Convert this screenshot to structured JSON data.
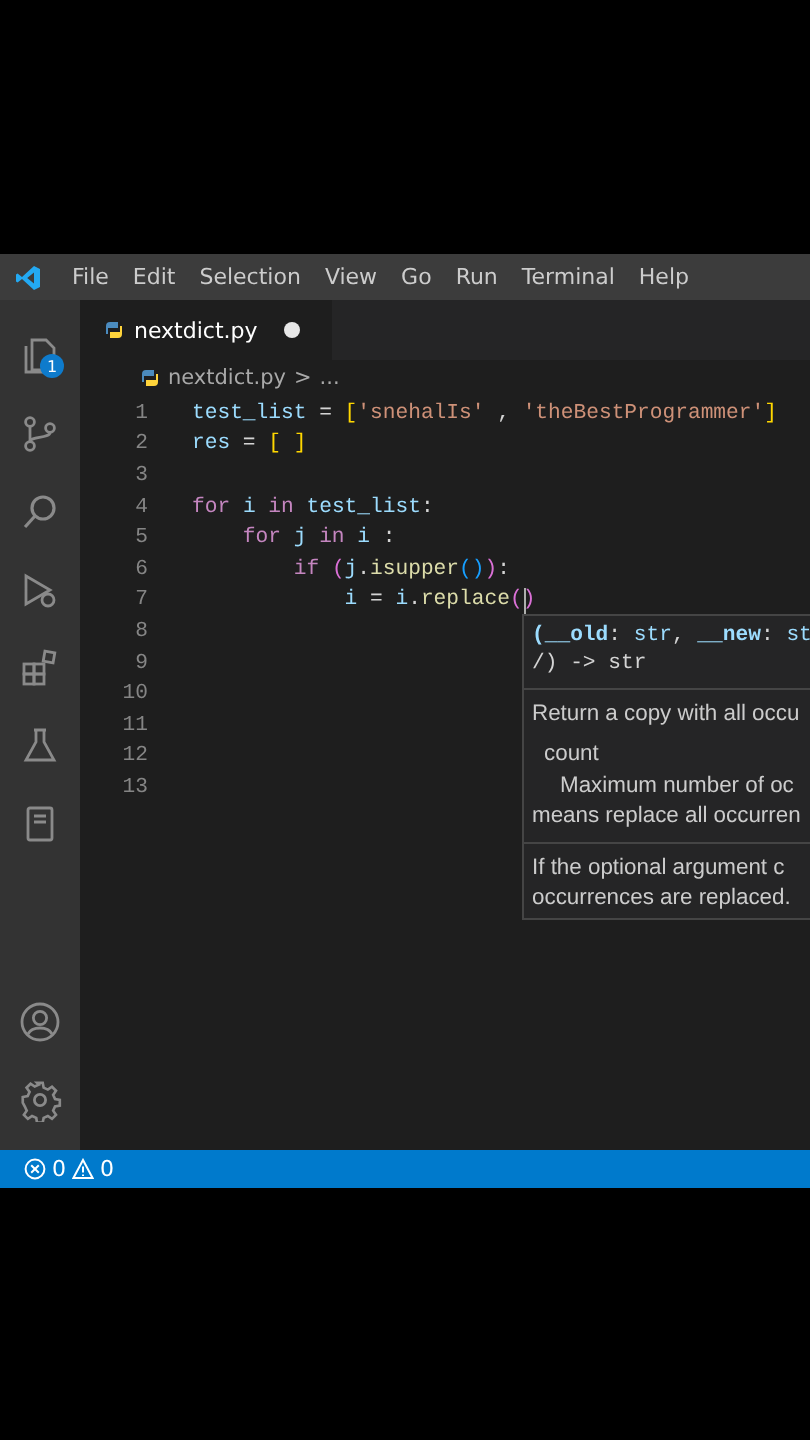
{
  "menu": [
    "File",
    "Edit",
    "Selection",
    "View",
    "Go",
    "Run",
    "Terminal",
    "Help"
  ],
  "activity": [
    {
      "kind": "files",
      "badge": "1"
    },
    {
      "kind": "branch"
    },
    {
      "kind": "search"
    },
    {
      "kind": "debug"
    },
    {
      "kind": "extensions"
    },
    {
      "kind": "flask"
    },
    {
      "kind": "book"
    }
  ],
  "activity_bottom": [
    {
      "kind": "account"
    },
    {
      "kind": "settings"
    }
  ],
  "tabs": [
    {
      "label": "nextdict.py",
      "selected": true,
      "modified": true
    }
  ],
  "breadcrumb": {
    "file": "nextdict.py",
    "separator": ">",
    "more": "..."
  },
  "code_lines": [
    {
      "number": "1",
      "tokens": [
        {
          "kind": "var",
          "text": "test_list"
        },
        {
          "kind": "punct",
          "text": " = "
        },
        {
          "kind": "bracket",
          "text": "["
        },
        {
          "kind": "string",
          "text": "'snehalIs'"
        },
        {
          "kind": "punct",
          "text": " , "
        },
        {
          "kind": "string",
          "text": "'theBestProgrammer'"
        },
        {
          "kind": "bracket",
          "text": "]"
        }
      ]
    },
    {
      "number": "2",
      "tokens": [
        {
          "kind": "var",
          "text": "res"
        },
        {
          "kind": "punct",
          "text": " = "
        },
        {
          "kind": "bracket",
          "text": "[ ]"
        }
      ]
    },
    {
      "number": "3"
    },
    {
      "number": "4",
      "tokens": [
        {
          "kind": "keyword",
          "text": "for "
        },
        {
          "kind": "var",
          "text": "i "
        },
        {
          "kind": "keyword",
          "text": "in "
        },
        {
          "kind": "var",
          "text": "test_list"
        },
        {
          "kind": "punct",
          "text": ":"
        }
      ]
    },
    {
      "number": "5",
      "tokens": [
        {
          "kind": "keyword",
          "text": "    for "
        },
        {
          "kind": "var",
          "text": "j "
        },
        {
          "kind": "keyword",
          "text": "in "
        },
        {
          "kind": "var",
          "text": "i"
        },
        {
          "kind": "punct",
          "text": " :"
        }
      ]
    },
    {
      "number": "6",
      "tokens": [
        {
          "kind": "keyword",
          "text": "        if "
        },
        {
          "kind": "bracket2",
          "text": "("
        },
        {
          "kind": "var",
          "text": "j"
        },
        {
          "kind": "punct",
          "text": "."
        },
        {
          "kind": "func",
          "text": "isupper"
        },
        {
          "kind": "bracket3",
          "text": "()"
        },
        {
          "kind": "bracket2",
          "text": ")"
        },
        {
          "kind": "punct",
          "text": ":"
        }
      ]
    },
    {
      "number": "7",
      "cursor": true,
      "tokens": [
        {
          "kind": "var",
          "text": "            i"
        },
        {
          "kind": "punct",
          "text": " = "
        },
        {
          "kind": "var",
          "text": "i"
        },
        {
          "kind": "punct",
          "text": "."
        },
        {
          "kind": "func",
          "text": "replace"
        },
        {
          "kind": "bracket2",
          "text": "("
        },
        {
          "kind": "bracket2",
          "text": ")"
        }
      ]
    },
    {
      "number": "8"
    },
    {
      "number": "9"
    },
    {
      "number": "10"
    },
    {
      "number": "11"
    },
    {
      "number": "12"
    },
    {
      "number": "13"
    }
  ],
  "hover": {
    "signature": [
      [
        {
          "kind": "param",
          "text": "(__old"
        },
        {
          "kind": "punct",
          "text": ": "
        },
        {
          "kind": "type",
          "text": "str"
        },
        {
          "kind": "punct",
          "text": ", "
        },
        {
          "kind": "param",
          "text": "__new"
        },
        {
          "kind": "punct",
          "text": ": "
        },
        {
          "kind": "type",
          "text": "st"
        }
      ],
      [
        {
          "kind": "punct",
          "text": "/) -> str"
        }
      ]
    ],
    "summary": "Return a copy with all occu",
    "param_name": "count",
    "param_doc": [
      "Maximum number of oc",
      "means replace all occurren"
    ],
    "note": [
      "If the optional argument c",
      "occurrences are replaced."
    ]
  },
  "status": {
    "errors": "0",
    "warnings": "0"
  }
}
